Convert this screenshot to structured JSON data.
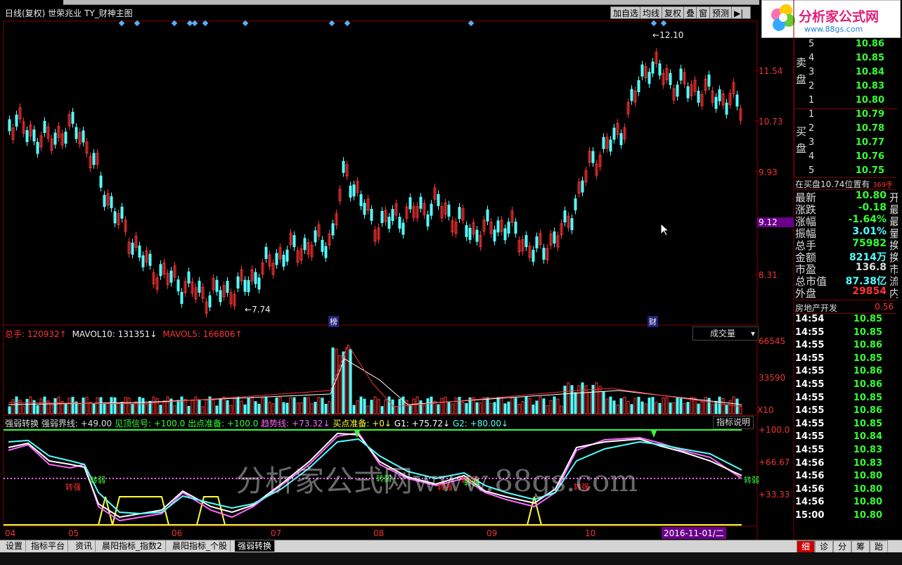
{
  "window": {
    "title": "日线(复权)  世荣兆业  TY_财神主图",
    "toolbar": [
      "加自选",
      "均线",
      "复权",
      "叠",
      "窗",
      "预测",
      "▶|"
    ]
  },
  "main_chart": {
    "y_axis_labels": [
      "11.54",
      "10.73",
      "9.93",
      "9.12",
      "8.31"
    ],
    "current_price_label": "9.12",
    "high_annotation": "12.10",
    "low_annotation": "7.74",
    "event_tags": [
      "榜",
      "财"
    ],
    "colors": {
      "up": "#ff3333",
      "down": "#54ffff",
      "grid": "#800000"
    }
  },
  "volume_pane": {
    "total_label": "总手: 120932↑",
    "mavol10_label": "MAVOL10: 131351↓",
    "mavol5_label": "MAVOL5: 166806↑",
    "indicator_select": "成交量",
    "y_axis_labels": [
      "66545",
      "33590",
      "X10"
    ]
  },
  "indicator_pane": {
    "legend": [
      {
        "text": "强弱转换",
        "color": "#dddddd"
      },
      {
        "text": "强弱界线: +49.00",
        "color": "#dddddd"
      },
      {
        "text": "见顶信号: +100.0",
        "color": "#33ff33"
      },
      {
        "text": "出点准备: +100.0",
        "color": "#33ff33"
      },
      {
        "text": "趋势线: +73.32↓",
        "color": "#ff66ff"
      },
      {
        "text": "买点准备: +0↓",
        "color": "#ffff33"
      },
      {
        "text": "G1: +75.72↓",
        "color": "#ffffff"
      },
      {
        "text": "G2: +80.00↓",
        "color": "#54ffff"
      }
    ],
    "help_button": "指标说明",
    "y_axis_labels": [
      "+100.0",
      "+66.67",
      "+33.33"
    ],
    "markers": [
      "转强",
      "转弱",
      "转弱",
      "转强",
      "转强",
      "转弱",
      "转强",
      "转弱"
    ]
  },
  "x_axis": {
    "months": [
      "04",
      "05",
      "06",
      "07",
      "08",
      "09",
      "10"
    ],
    "cursor_date": "2016-11-01/二"
  },
  "order_book": {
    "sell_label": "卖盘",
    "buy_label": "买盘",
    "sell": [
      {
        "level": "5",
        "price": "10.86"
      },
      {
        "level": "4",
        "price": "10.85"
      },
      {
        "level": "3",
        "price": "10.84"
      },
      {
        "level": "2",
        "price": "10.83"
      },
      {
        "level": "1",
        "price": "10.80"
      }
    ],
    "buy": [
      {
        "level": "1",
        "price": "10.79"
      },
      {
        "level": "2",
        "price": "10.78"
      },
      {
        "level": "3",
        "price": "10.77"
      },
      {
        "level": "4",
        "price": "10.76"
      },
      {
        "level": "5",
        "price": "10.75"
      }
    ],
    "notice": "在买盘10.74位置有",
    "notice_tail": "369手"
  },
  "quote": [
    {
      "label": "最新",
      "value": "10.80",
      "tail": "开",
      "color": "#33ff33"
    },
    {
      "label": "涨跌",
      "value": "-0.18",
      "tail": "最",
      "color": "#33ff33"
    },
    {
      "label": "涨幅",
      "value": "-1.64%",
      "tail": "最",
      "color": "#33ff33"
    },
    {
      "label": "振幅",
      "value": "3.01%",
      "tail": "量",
      "color": "#54ffff"
    },
    {
      "label": "总手",
      "value": "75982",
      "tail": "换",
      "color": "#33ff33"
    },
    {
      "label": "金额",
      "value": "8214万",
      "tail": "换",
      "color": "#54ffff"
    },
    {
      "label": "市盈",
      "value": "136.8",
      "tail": "市",
      "color": "#dddddd"
    },
    {
      "label": "总市值",
      "value": "87.38亿",
      "tail": "流",
      "color": "#54ffff"
    },
    {
      "label": "外盘",
      "value": "29854",
      "tail": "内",
      "color": "#ff3333"
    }
  ],
  "sector": {
    "name": "房地产开发",
    "change": "0.56"
  },
  "ticks": [
    {
      "time": "14:54",
      "price": "10.85"
    },
    {
      "time": "14:55",
      "price": "10.85"
    },
    {
      "time": "14:55",
      "price": "10.86"
    },
    {
      "time": "14:55",
      "price": "10.85"
    },
    {
      "time": "14:55",
      "price": "10.86"
    },
    {
      "time": "14:55",
      "price": "10.86"
    },
    {
      "time": "14:55",
      "price": "10.85"
    },
    {
      "time": "14:55",
      "price": "10.86"
    },
    {
      "time": "14:55",
      "price": "10.85"
    },
    {
      "time": "14:55",
      "price": "10.84"
    },
    {
      "time": "14:55",
      "price": "10.83"
    },
    {
      "time": "14:56",
      "price": "10.83"
    },
    {
      "time": "14:56",
      "price": "10.80"
    },
    {
      "time": "14:56",
      "price": "10.80"
    },
    {
      "time": "14:56",
      "price": "10.80"
    },
    {
      "time": "15:00",
      "price": "10.80"
    }
  ],
  "bottom_tabs": [
    "设置",
    "指标平台",
    "资讯",
    "晨阳指标_指数2",
    "晨阳指标_个股",
    "强弱转换"
  ],
  "right_tabs": [
    "细",
    "诊",
    "分",
    "筹",
    "跆"
  ],
  "logo": {
    "text": "分析家公式网",
    "url_text": "www.88gs.com"
  },
  "watermark": "分析家公式网www.88gs.com"
}
